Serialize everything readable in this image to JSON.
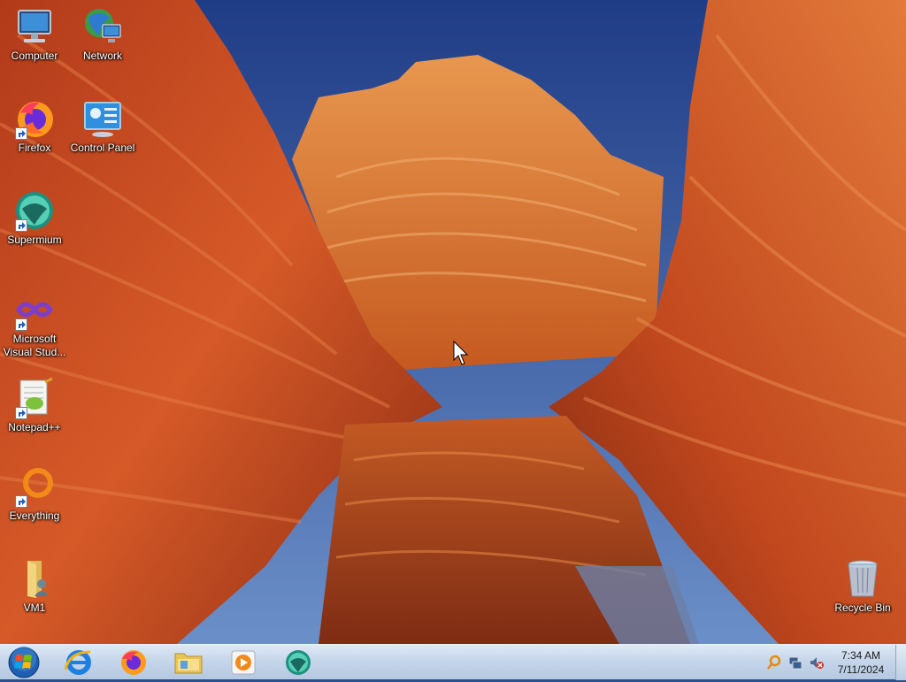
{
  "desktop": {
    "icons": [
      {
        "label": "Computer",
        "icon": "computer-icon"
      },
      {
        "label": "Network",
        "icon": "network-icon"
      },
      {
        "label": "Firefox",
        "icon": "firefox-icon"
      },
      {
        "label": "Control Panel",
        "icon": "control-panel-icon"
      },
      {
        "label": "Supermium",
        "icon": "supermium-icon"
      },
      {
        "label": "Microsoft Visual Stud...",
        "icon": "visual-studio-icon"
      },
      {
        "label": "Notepad++",
        "icon": "notepad-plus-plus-icon"
      },
      {
        "label": "Everything",
        "icon": "everything-search-icon"
      },
      {
        "label": "VM1",
        "icon": "folder-user-icon"
      },
      {
        "label": "Recycle Bin",
        "icon": "recycle-bin-icon"
      }
    ]
  },
  "taskbar": {
    "start": {
      "icon": "windows-orb-icon"
    },
    "pinned": [
      {
        "icon": "internet-explorer-icon"
      },
      {
        "icon": "firefox-icon"
      },
      {
        "icon": "file-explorer-icon"
      },
      {
        "icon": "media-player-icon"
      },
      {
        "icon": "supermium-icon"
      }
    ],
    "tray": {
      "icons": [
        "search-tray-icon",
        "network-tray-icon",
        "volume-muted-icon"
      ],
      "time": "7:34 AM",
      "date": "7/11/2024"
    }
  },
  "colors": {
    "taskbar_top": "#dfe9f5",
    "taskbar_bottom": "#b4c8e1",
    "sky": "#2c4f8f",
    "rock": "#d9642a"
  }
}
